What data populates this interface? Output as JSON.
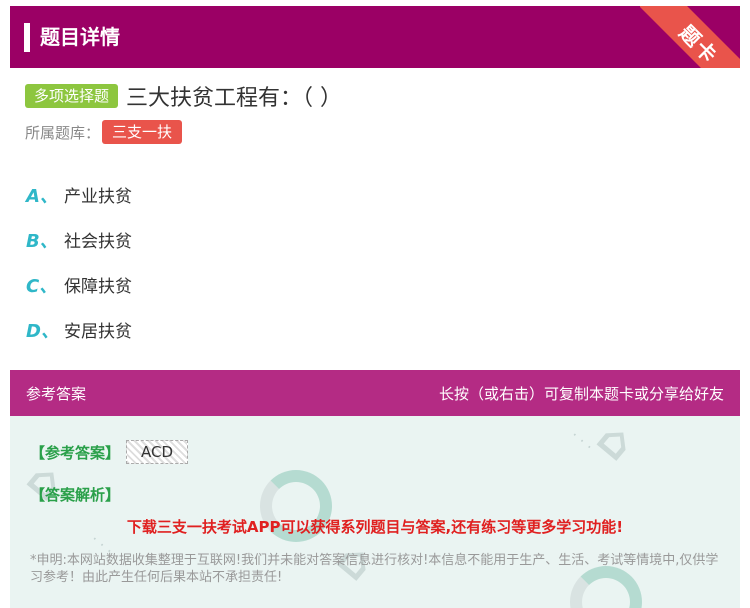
{
  "header": {
    "title": "题目详情",
    "ribbon_label": "题卡"
  },
  "question": {
    "type_badge": "多项选择题",
    "text": "三大扶贫工程有：（   ）",
    "bank_label": "所属题库：",
    "bank_tag": "三支一扶"
  },
  "options": [
    {
      "letter": "A、",
      "text": "产业扶贫"
    },
    {
      "letter": "B、",
      "text": "社会扶贫"
    },
    {
      "letter": "C、",
      "text": "保障扶贫"
    },
    {
      "letter": "D、",
      "text": "安居扶贫"
    }
  ],
  "answer": {
    "header_left": "参考答案",
    "header_right": "长按（或右击）可复制本题卡或分享给好友",
    "ref_label": "【参考答案】",
    "ref_value": "ACD",
    "analysis_label": "【答案解析】",
    "promo": "下载三支一扶考试APP可以获得系列题目与答案,还有练习等更多学习功能!",
    "disclaimer": "*申明:本网站数据收集整理于互联网!我们并未能对答案信息进行核对!本信息不能用于生产、生活、考试等情境中,仅供学习参考！由此产生任何后果本站不承担责任!"
  },
  "colors": {
    "header_bg": "#9b0065",
    "answer_header_bg": "#b42b84",
    "badge_green": "#8dc63f",
    "tag_red": "#e9544b",
    "option_letter": "#2fb7c8",
    "promo_red": "#e02020"
  }
}
